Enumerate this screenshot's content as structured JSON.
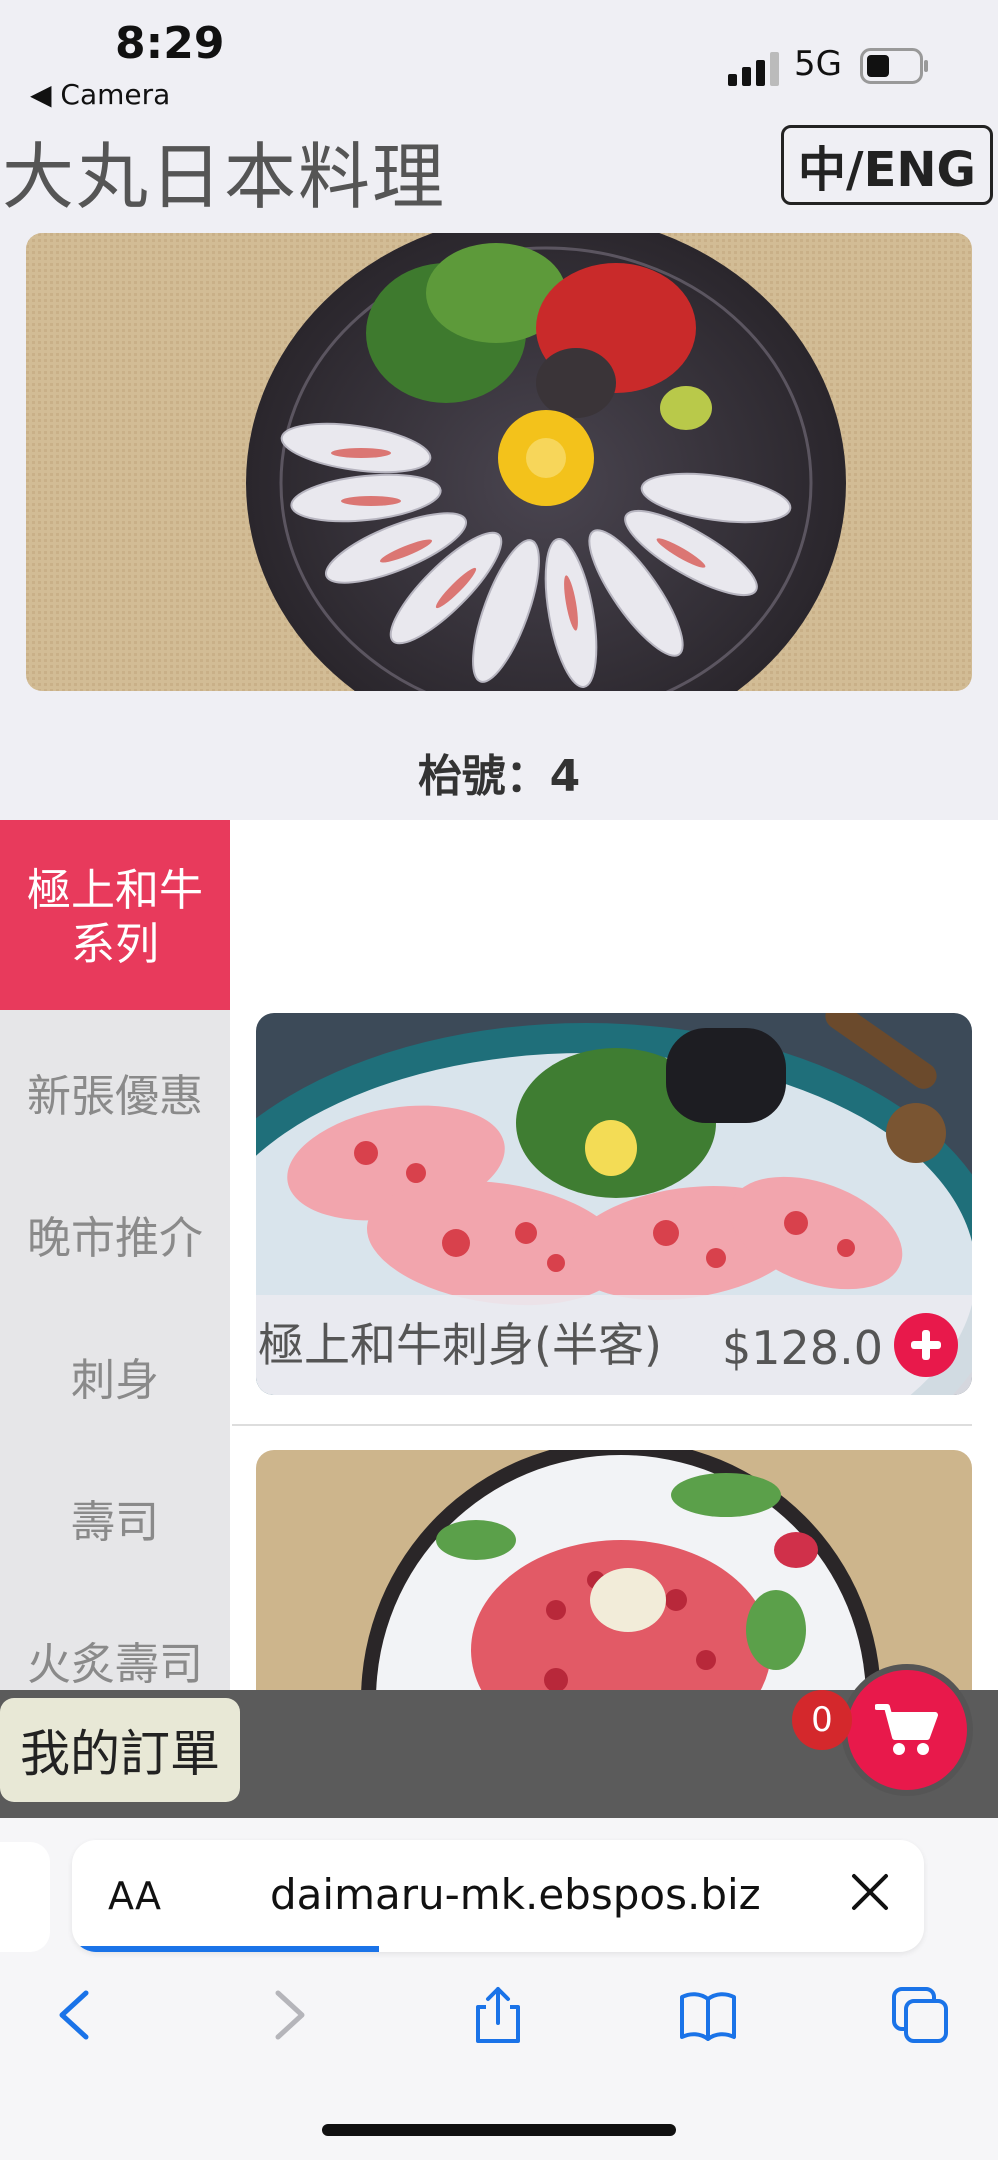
{
  "status": {
    "time": "8:29",
    "back_label": "◀ Camera",
    "network": "5G"
  },
  "header": {
    "title": "大丸日本料理",
    "lang_toggle": "中/ENG"
  },
  "table": {
    "label": "枱號：4"
  },
  "categories": [
    {
      "label": "極上和牛\n系列",
      "active": true
    },
    {
      "label": "新張優惠",
      "active": false
    },
    {
      "label": "晚市推介",
      "active": false
    },
    {
      "label": "刺身",
      "active": false
    },
    {
      "label": "壽司",
      "active": false
    },
    {
      "label": "火炙壽司",
      "active": false
    }
  ],
  "dishes": [
    {
      "name": "極上和牛刺身(半客)",
      "price": "$128.0"
    }
  ],
  "order_bar": {
    "my_order_label": "我的訂單",
    "cart_count": "0"
  },
  "browser": {
    "text_size_label": "AA",
    "url": "daimaru-mk.ebspos.biz",
    "load_progress": 0.36
  },
  "colors": {
    "accent": "#e8194b",
    "active_category": "#e83a5c",
    "order_bar": "#5b5b5b",
    "progress": "#1a73e8"
  }
}
